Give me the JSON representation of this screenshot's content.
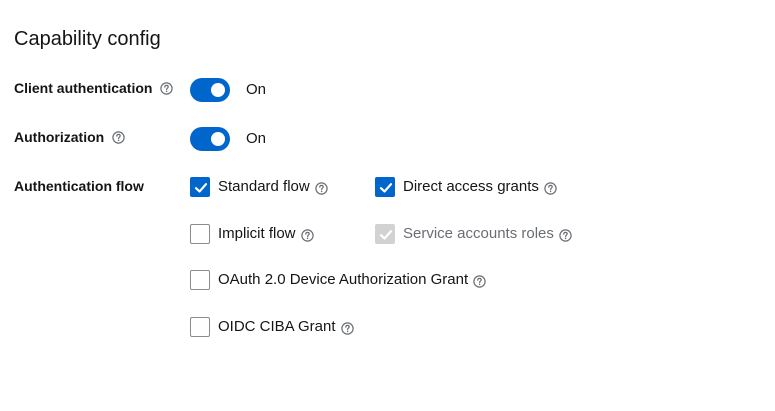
{
  "section": {
    "title": "Capability config"
  },
  "client_authentication": {
    "label": "Client authentication",
    "help_icon": "question-circle-icon",
    "toggle_state": "On",
    "enabled": true
  },
  "authorization": {
    "label": "Authorization",
    "help_icon": "question-circle-icon",
    "toggle_state": "On",
    "enabled": true
  },
  "authentication_flow": {
    "label": "Authentication flow",
    "options": [
      {
        "label": "Standard flow",
        "checked": true,
        "disabled": false
      },
      {
        "label": "Direct access grants",
        "checked": true,
        "disabled": false
      },
      {
        "label": "Implicit flow",
        "checked": false,
        "disabled": false
      },
      {
        "label": "Service accounts roles",
        "checked": true,
        "disabled": true
      },
      {
        "label": "OAuth 2.0 Device Authorization Grant",
        "checked": false,
        "disabled": false
      },
      {
        "label": "OIDC CIBA Grant",
        "checked": false,
        "disabled": false
      }
    ]
  },
  "colors": {
    "accent": "#0066cc",
    "text": "#151515",
    "disabled": "#d2d2d2",
    "help_icon": "#6a6e73"
  }
}
